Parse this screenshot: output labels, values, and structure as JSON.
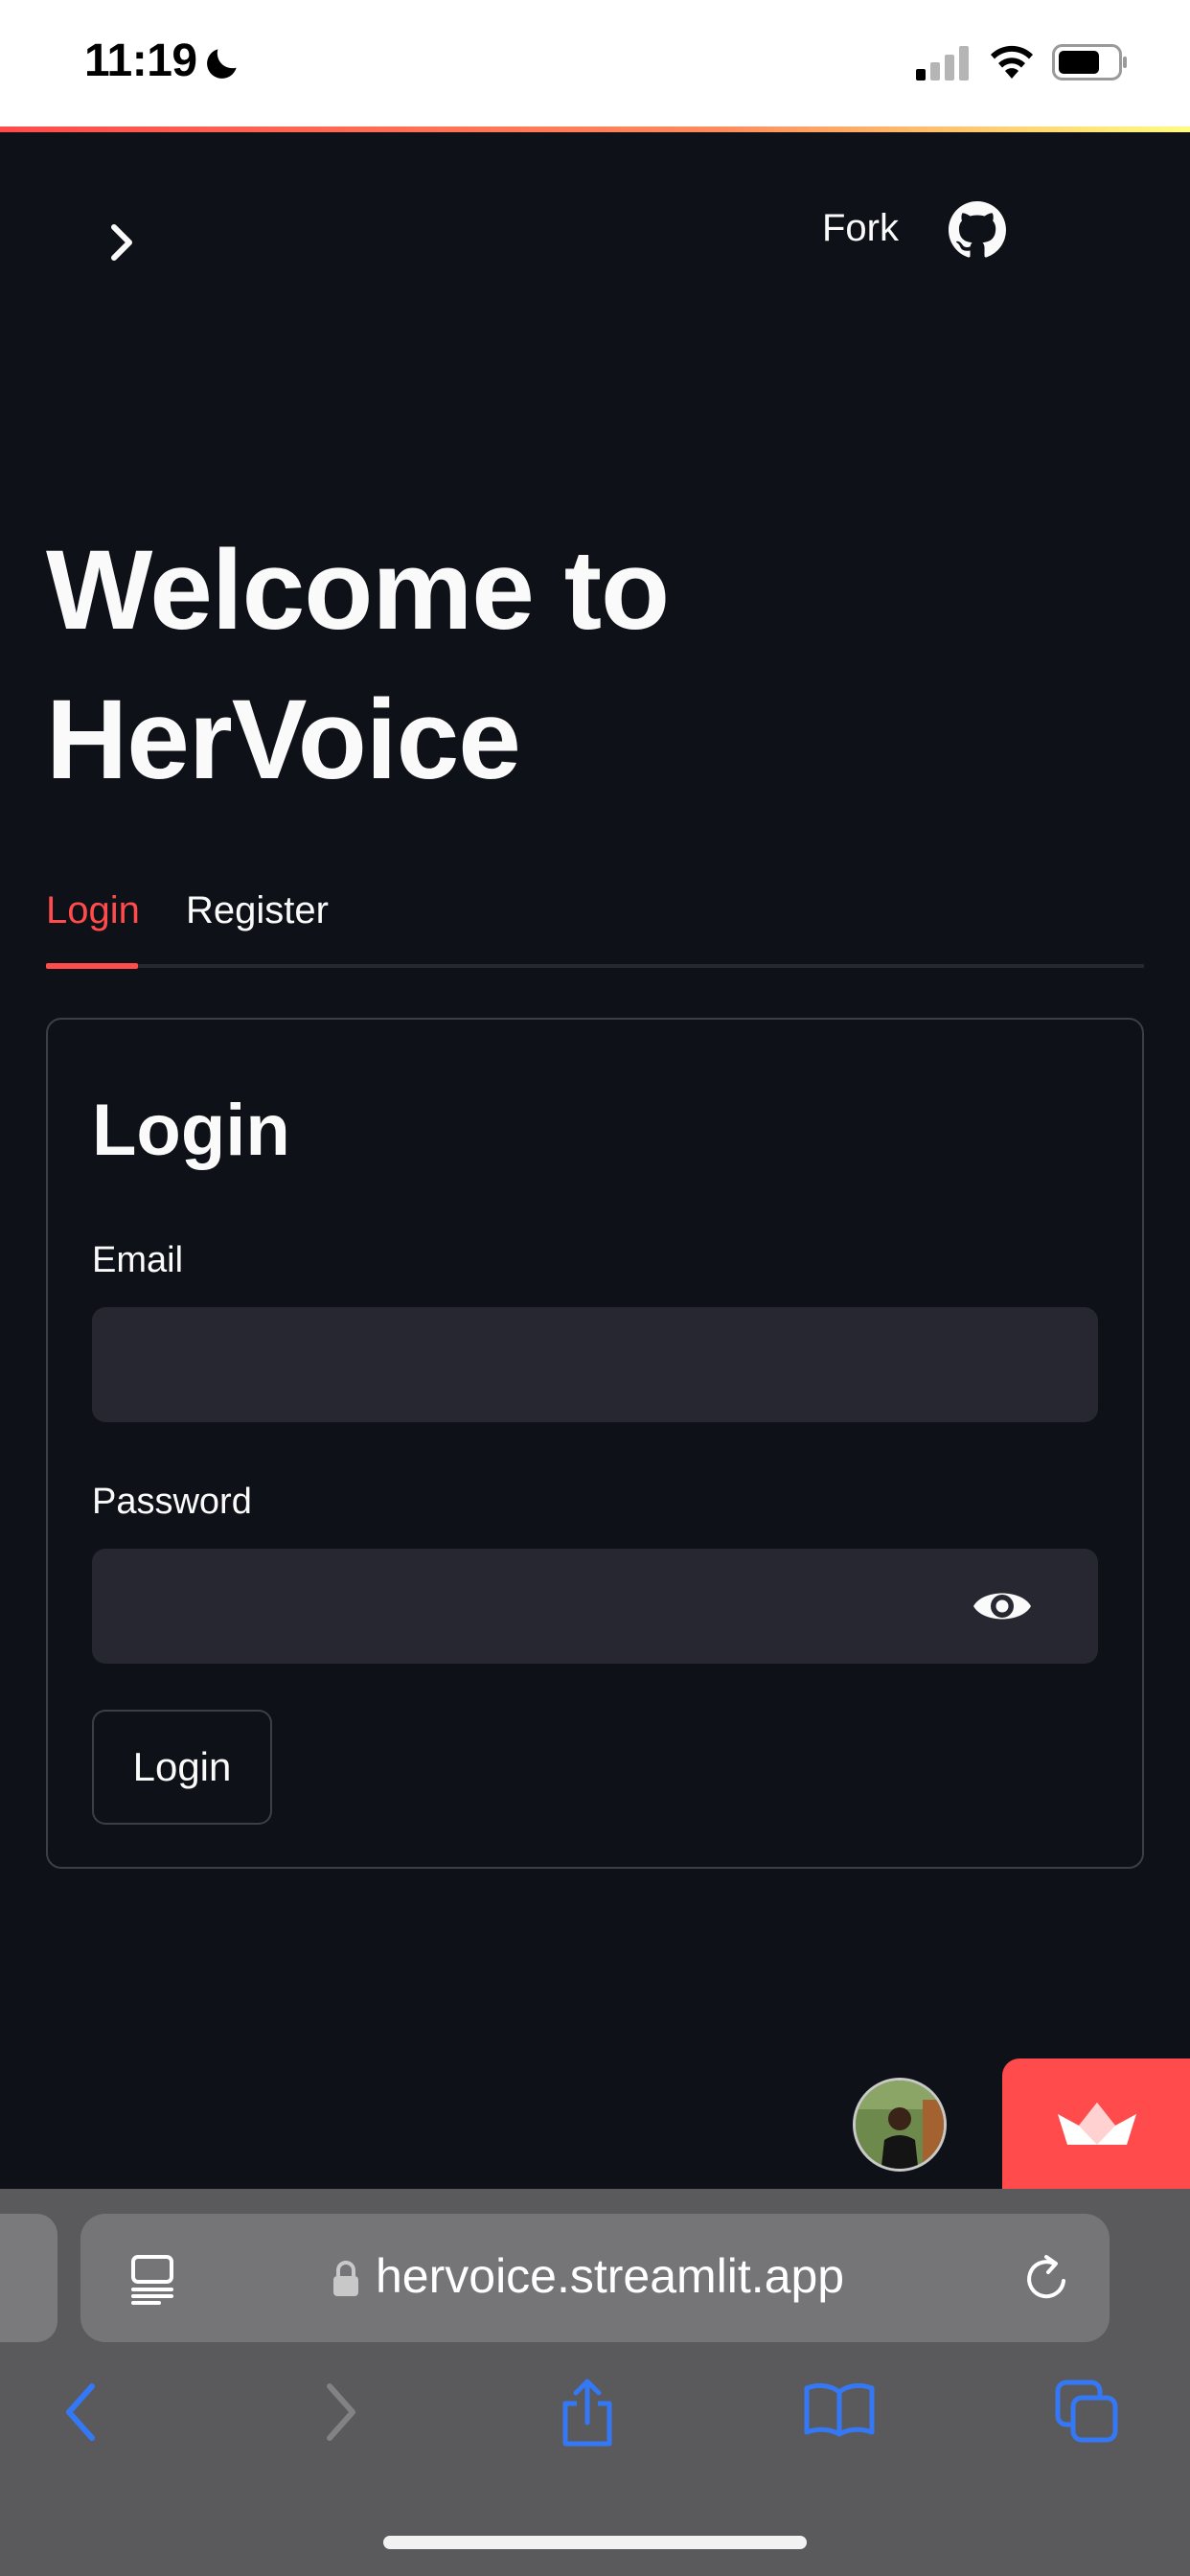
{
  "status_bar": {
    "time": "11:19"
  },
  "header": {
    "fork_label": "Fork"
  },
  "page": {
    "title_line1": "Welcome to",
    "title_line2": "HerVoice"
  },
  "tabs": [
    {
      "label": "Login",
      "active": true
    },
    {
      "label": "Register",
      "active": false
    }
  ],
  "form": {
    "title": "Login",
    "email_label": "Email",
    "email_value": "",
    "password_label": "Password",
    "password_value": "",
    "submit_label": "Login"
  },
  "browser": {
    "url": "hervoice.streamlit.app"
  },
  "colors": {
    "background": "#0e1117",
    "accent": "#ff4b4b",
    "input_bg": "#262730",
    "safari_bar": "#5a5a5c",
    "ios_blue": "#3478f6"
  },
  "icons": [
    "moon-icon",
    "signal-icon",
    "wifi-icon",
    "battery-icon",
    "chevron-right-icon",
    "github-icon",
    "eye-icon",
    "streamlit-crown-icon",
    "reader-icon",
    "lock-icon",
    "reload-icon",
    "back-icon",
    "forward-icon",
    "share-icon",
    "bookmarks-icon",
    "tabs-icon"
  ]
}
